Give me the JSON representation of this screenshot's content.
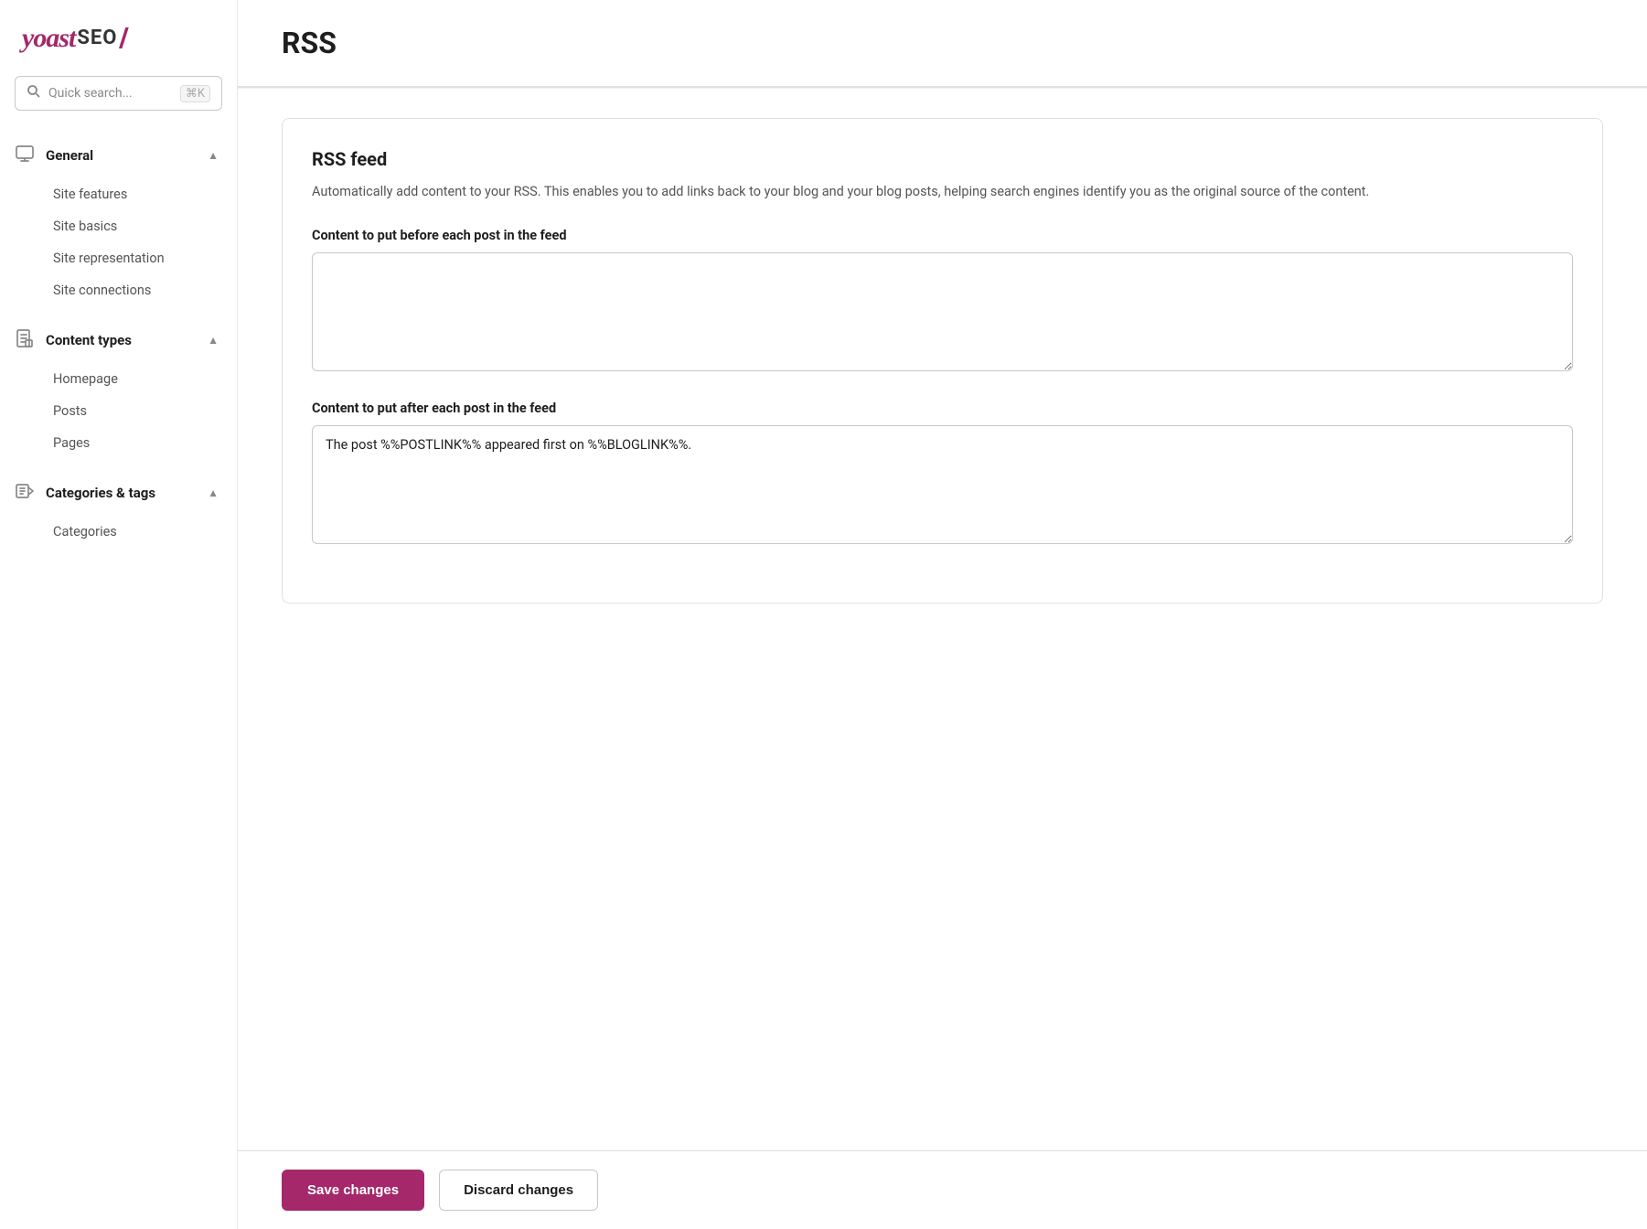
{
  "logo": {
    "yoast": "yoast",
    "seo": "SEO",
    "slash": "/"
  },
  "search": {
    "placeholder": "Quick search...",
    "shortcut": "⌘K"
  },
  "sidebar": {
    "sections": [
      {
        "id": "general",
        "label": "General",
        "icon": "monitor-icon",
        "expanded": true,
        "items": [
          {
            "id": "site-features",
            "label": "Site features"
          },
          {
            "id": "site-basics",
            "label": "Site basics"
          },
          {
            "id": "site-representation",
            "label": "Site representation"
          },
          {
            "id": "site-connections",
            "label": "Site connections"
          }
        ]
      },
      {
        "id": "content-types",
        "label": "Content types",
        "icon": "document-icon",
        "expanded": true,
        "items": [
          {
            "id": "homepage",
            "label": "Homepage"
          },
          {
            "id": "posts",
            "label": "Posts"
          },
          {
            "id": "pages",
            "label": "Pages"
          }
        ]
      },
      {
        "id": "categories-tags",
        "label": "Categories & tags",
        "icon": "tag-icon",
        "expanded": true,
        "items": [
          {
            "id": "categories",
            "label": "Categories"
          }
        ]
      }
    ]
  },
  "page": {
    "title": "RSS"
  },
  "rss_feed": {
    "section_title": "RSS feed",
    "description": "Automatically add content to your RSS. This enables you to add links back to your blog and your blog posts, helping search engines identify you as the original source of the content.",
    "before_label": "Content to put before each post in the feed",
    "before_value": "",
    "after_label": "Content to put after each post in the feed",
    "after_value": "The post %%POSTLINK%% appeared first on %%BLOGLINK%%."
  },
  "actions": {
    "save_label": "Save changes",
    "discard_label": "Discard changes"
  }
}
